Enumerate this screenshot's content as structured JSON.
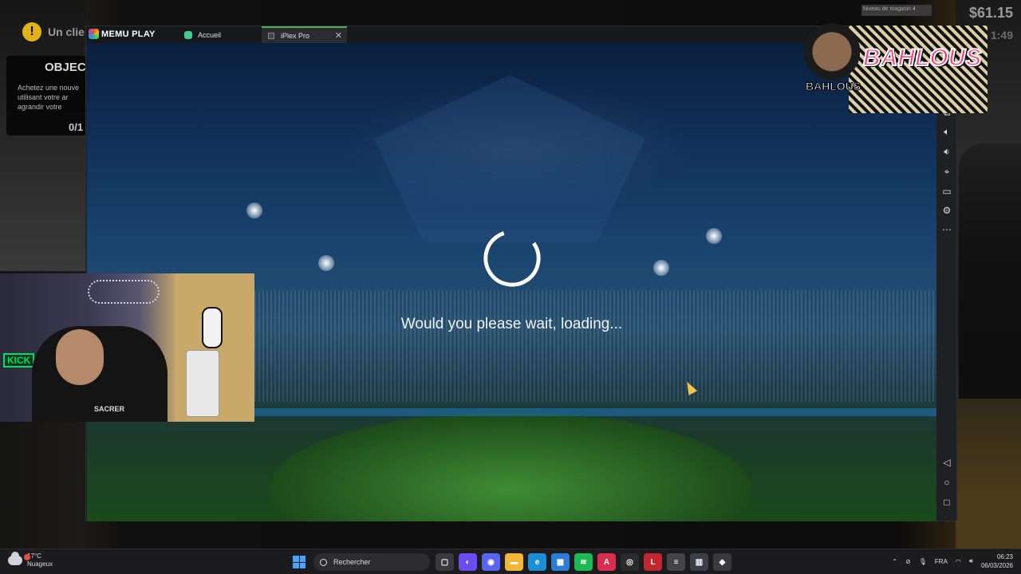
{
  "desktop": {
    "notice_text": "Un clie",
    "quest_title": "OBJEC",
    "quest_desc": "Achetez une nouve utilisant votre ar agrandir votre",
    "quest_count": "0/1",
    "money": "$61.15",
    "money_sub": "1:49",
    "level_label": "Niveau de magasin 4"
  },
  "emulator": {
    "logo_text": "MEMU PLAY",
    "tabs": [
      {
        "label": "Accueil",
        "icon": "home-app-icon"
      },
      {
        "label": "iPlex Pro",
        "icon": "app-icon",
        "close": "✕"
      }
    ],
    "loading_text": "Would you please wait, loading...",
    "side_buttons": [
      "multi-window-icon",
      "volume-up-icon",
      "volume-down-icon",
      "location-icon",
      "folder-icon",
      "settings-icon",
      "more-icon"
    ],
    "nav_buttons": [
      "back-icon",
      "home-icon",
      "recents-icon"
    ]
  },
  "overlay": {
    "avatar_label": "BAHLOUS",
    "brand_name": "BAHLOUS"
  },
  "webcam": {
    "sign_text": "KICK",
    "shirt_text": "SACRER"
  },
  "taskbar": {
    "weather_temp": "17°C",
    "weather_desc": "Nuageux",
    "search_placeholder": "Rechercher",
    "language": "FRA",
    "time": "06:23",
    "date": "06/03/2026",
    "apps": [
      {
        "name": "task-view",
        "color": "#3a3a3e",
        "glyph": "▢"
      },
      {
        "name": "copilot",
        "color": "#6a4df0",
        "glyph": "◐"
      },
      {
        "name": "discord",
        "color": "#5865f2",
        "glyph": "◉"
      },
      {
        "name": "file-explorer",
        "color": "#f2b632",
        "glyph": "▬"
      },
      {
        "name": "edge",
        "color": "#1b8fd6",
        "glyph": "e"
      },
      {
        "name": "store",
        "color": "#2d7cd6",
        "glyph": "▦"
      },
      {
        "name": "spotify",
        "color": "#1db954",
        "glyph": "≋"
      },
      {
        "name": "arc",
        "color": "#d92e4f",
        "glyph": "A"
      },
      {
        "name": "obs",
        "color": "#2b2b2b",
        "glyph": "◎"
      },
      {
        "name": "app-red",
        "color": "#c0282d",
        "glyph": "L"
      },
      {
        "name": "app-gray",
        "color": "#444",
        "glyph": "≡"
      },
      {
        "name": "app-building",
        "color": "#3b3f4a",
        "glyph": "▥"
      },
      {
        "name": "memu",
        "color": "#3a3a3e",
        "glyph": "◆"
      }
    ]
  }
}
